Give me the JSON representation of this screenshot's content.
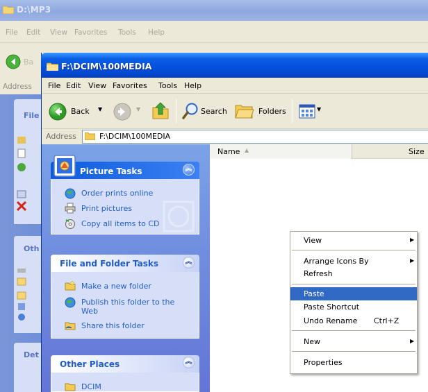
{
  "back_window": {
    "title": "D:\\MP3",
    "menu": [
      "File",
      "Edit",
      "View",
      "Favorites",
      "Tools",
      "Help"
    ],
    "back_label": "Ba",
    "address_label": "Address",
    "panels": [
      "File",
      "Oth",
      "Det"
    ]
  },
  "window": {
    "title": "F:\\DCIM\\100MEDIA",
    "menu": [
      "File",
      "Edit",
      "View",
      "Favorites",
      "Tools",
      "Help"
    ]
  },
  "toolbar": {
    "back_label": "Back",
    "search_label": "Search",
    "folders_label": "Folders"
  },
  "address": {
    "label": "Address",
    "value": "F:\\DCIM\\100MEDIA"
  },
  "task_pane": {
    "picture_tasks": {
      "title": "Picture Tasks",
      "items": [
        "Order prints online",
        "Print pictures",
        "Copy all items to CD"
      ]
    },
    "file_folder_tasks": {
      "title": "File and Folder Tasks",
      "items": [
        "Make a new folder",
        "Publish this folder to the",
        "Web",
        "Share this folder"
      ]
    },
    "other_places": {
      "title": "Other Places",
      "items": [
        "DCIM"
      ]
    }
  },
  "file_list": {
    "columns": [
      "Name",
      "Size"
    ]
  },
  "context_menu": {
    "items": [
      {
        "label": "View",
        "submenu": true
      },
      {
        "label": "Arrange Icons By",
        "submenu": true
      },
      {
        "label": "Refresh"
      },
      {
        "label": "Paste",
        "highlighted": true
      },
      {
        "label": "Paste Shortcut"
      },
      {
        "label": "Undo Rename",
        "shortcut": "Ctrl+Z"
      },
      {
        "label": "New",
        "submenu": true
      },
      {
        "label": "Properties"
      }
    ]
  },
  "colors": {
    "titlebar": "#0a5fe5",
    "task_pane_bg": "#6f8ad9",
    "panel_body": "#d6dff7",
    "link": "#215dc6",
    "menu_highlight": "#316ac5"
  }
}
